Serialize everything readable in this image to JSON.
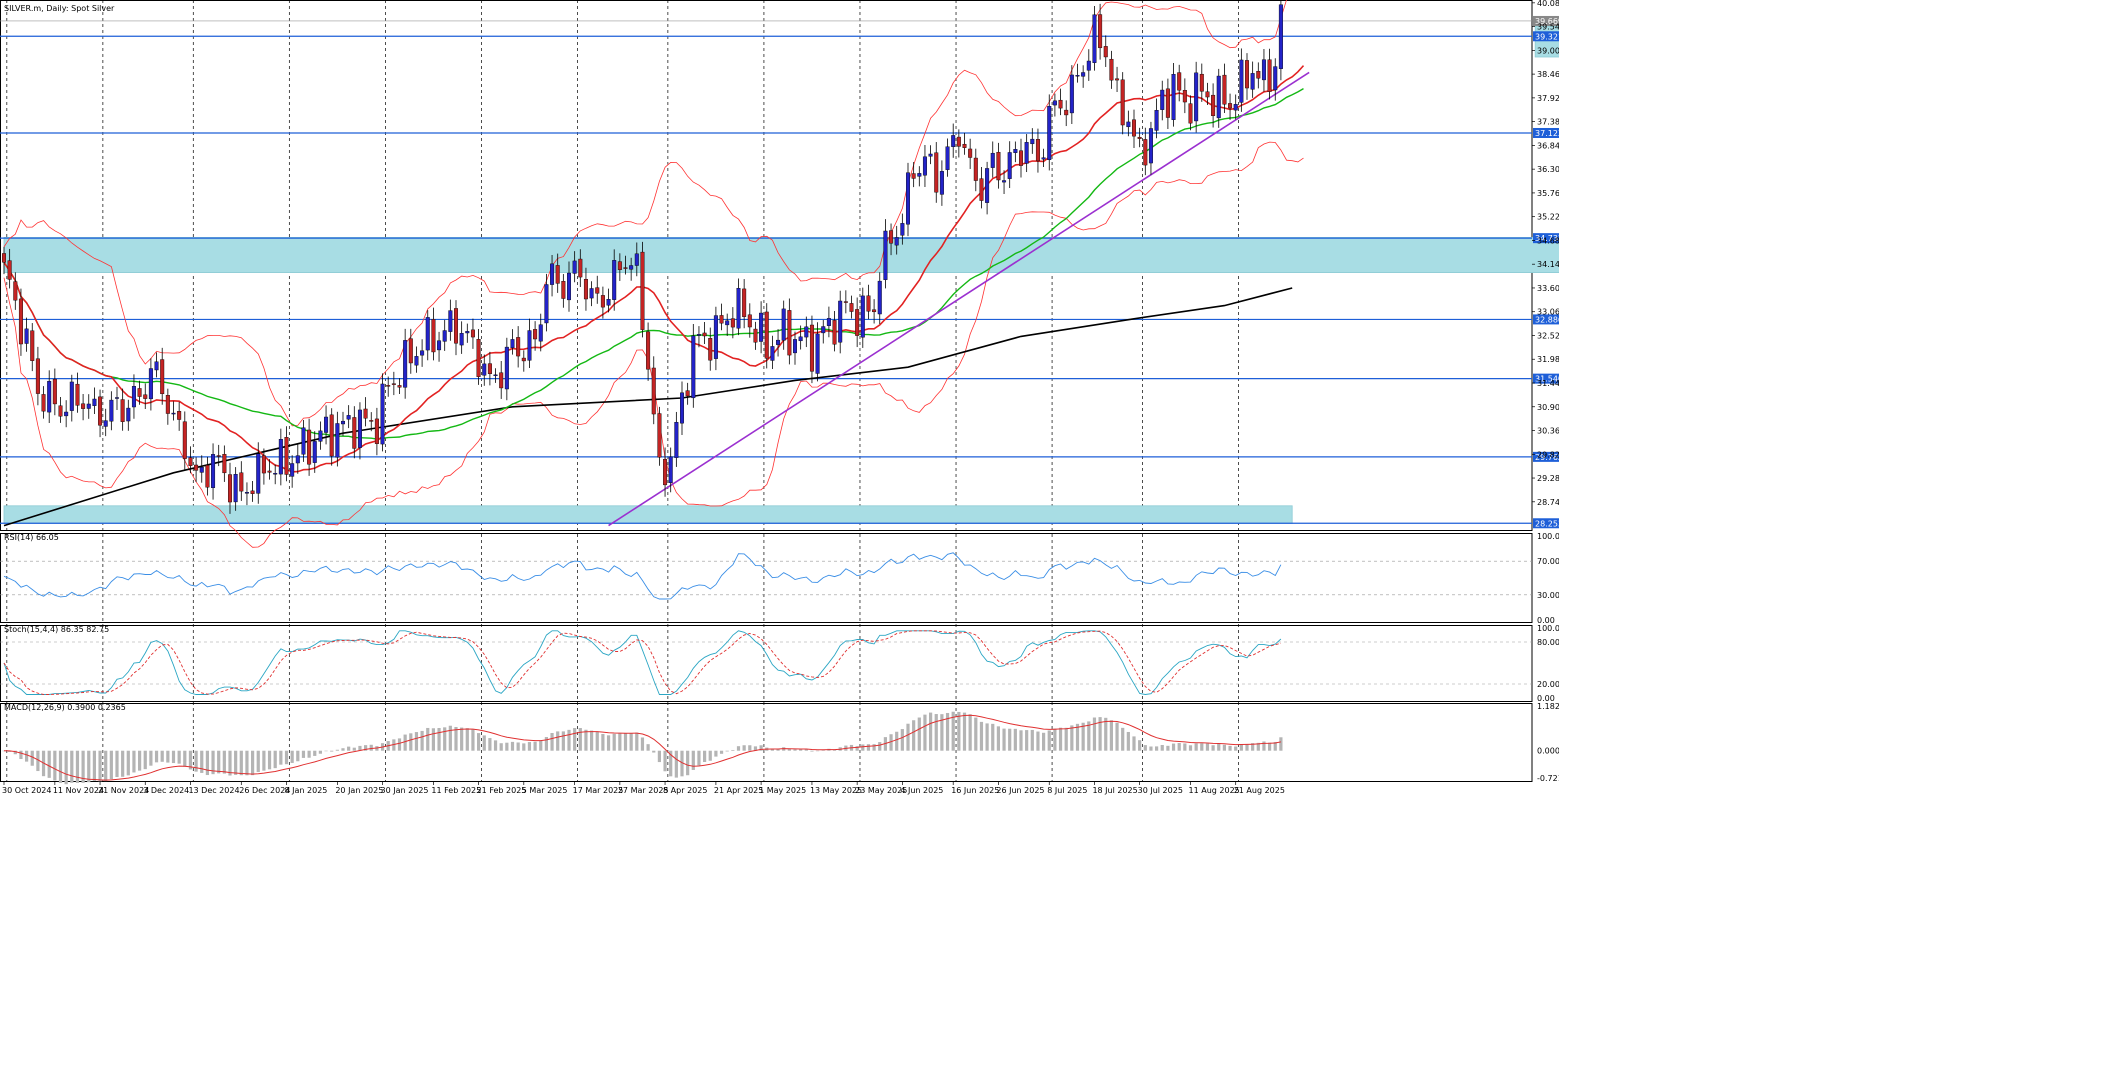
{
  "header": {
    "main": "SILVER.m, Daily:  Spot Silver",
    "rsi": "RSI(14) 66.05",
    "stoch": "Stoch(15,4,4) 86.35 82.75",
    "macd": "MACD(12,26,9) 0.3900 0.2365"
  },
  "colors": {
    "bull": "#2323c8",
    "bear": "#c42424",
    "ma20": "#e22222",
    "ma50": "#14b814",
    "ma200": "#000000",
    "bands": "#ff3333",
    "trend": "#9b30d0",
    "levels": "#1e5fd8",
    "zones": "#a8dde4",
    "rsi": "#3a8ee6",
    "stoch_main": "#2ba6c4",
    "stoch_signal": "#e03030",
    "macd_hist": "#b4b4b4",
    "macd_signal": "#e03030"
  },
  "chart_data": {
    "type": "candlestick",
    "price_axis": {
      "min": 28.1,
      "max": 40.1,
      "ticks": [
        "40.081",
        "39.541",
        "39.001",
        "38.461",
        "37.921",
        "37.381",
        "36.841",
        "36.301",
        "35.761",
        "35.221",
        "34.681",
        "34.141",
        "33.601",
        "33.061",
        "32.521",
        "31.981",
        "31.441",
        "30.901",
        "30.361",
        "29.821",
        "29.281",
        "28.741"
      ]
    },
    "horizontal_levels": [
      {
        "label": "39.321",
        "value": 39.321
      },
      {
        "label": "37.123",
        "value": 37.123
      },
      {
        "label": "34.733",
        "value": 34.733
      },
      {
        "label": "32.886",
        "value": 32.886
      },
      {
        "label": "31.540",
        "value": 31.54
      },
      {
        "label": "29.762",
        "value": 29.762
      },
      {
        "label": "28.253",
        "value": 28.253
      }
    ],
    "current_price": {
      "label": "39.669",
      "value": 39.669
    },
    "zones": [
      {
        "name": "upper",
        "x0": 271,
        "x1": 331,
        "y0": 38.85,
        "y1": 39.55
      },
      {
        "name": "middle",
        "x0": 0,
        "x1": 288,
        "y0": 33.95,
        "y1": 34.75
      },
      {
        "name": "lower",
        "x0": 0,
        "x1": 228,
        "y0": 28.25,
        "y1": 28.65
      }
    ],
    "x_ticks": [
      {
        "i": 0,
        "label": "30 Oct 2024"
      },
      {
        "i": 9,
        "label": "11 Nov 2024"
      },
      {
        "i": 17,
        "label": "21 Nov 2024"
      },
      {
        "i": 25,
        "label": "3 Dec 2024"
      },
      {
        "i": 33,
        "label": "13 Dec 2024"
      },
      {
        "i": 42,
        "label": "26 Dec 2024"
      },
      {
        "i": 50,
        "label": "8 Jan 2025"
      },
      {
        "i": 59,
        "label": "20 Jan 2025"
      },
      {
        "i": 67,
        "label": "30 Jan 2025"
      },
      {
        "i": 76,
        "label": "11 Feb 2025"
      },
      {
        "i": 84,
        "label": "21 Feb 2025"
      },
      {
        "i": 92,
        "label": "5 Mar 2025"
      },
      {
        "i": 101,
        "label": "17 Mar 2025"
      },
      {
        "i": 109,
        "label": "27 Mar 2025"
      },
      {
        "i": 117,
        "label": "8 Apr 2025"
      },
      {
        "i": 126,
        "label": "21 Apr 2025"
      },
      {
        "i": 134,
        "label": "1 May 2025"
      },
      {
        "i": 143,
        "label": "13 May 2025"
      },
      {
        "i": 151,
        "label": "23 May 2025"
      },
      {
        "i": 159,
        "label": "4 Jun 2025"
      },
      {
        "i": 168,
        "label": "16 Jun 2025"
      },
      {
        "i": 176,
        "label": "26 Jun 2025"
      },
      {
        "i": 185,
        "label": "8 Jul 2025"
      },
      {
        "i": 193,
        "label": "18 Jul 2025"
      },
      {
        "i": 201,
        "label": "30 Jul 2025"
      },
      {
        "i": 210,
        "label": "11 Aug 2025"
      },
      {
        "i": 218,
        "label": "21 Aug 2025"
      }
    ],
    "anchors": [
      [
        0,
        34.0
      ],
      [
        3,
        32.7
      ],
      [
        6,
        31.3
      ],
      [
        10,
        31.0
      ],
      [
        14,
        31.0
      ],
      [
        16,
        30.6
      ],
      [
        20,
        31.0
      ],
      [
        24,
        31.1
      ],
      [
        26,
        31.6
      ],
      [
        28,
        31.3
      ],
      [
        30,
        30.6
      ],
      [
        32,
        30.2
      ],
      [
        34,
        29.3
      ],
      [
        37,
        29.6
      ],
      [
        40,
        29.1
      ],
      [
        42,
        28.9
      ],
      [
        44,
        29.4
      ],
      [
        47,
        29.6
      ],
      [
        50,
        29.5
      ],
      [
        53,
        29.9
      ],
      [
        56,
        30.4
      ],
      [
        60,
        30.4
      ],
      [
        63,
        30.4
      ],
      [
        66,
        30.6
      ],
      [
        68,
        31.5
      ],
      [
        72,
        32.0
      ],
      [
        76,
        32.4
      ],
      [
        80,
        32.9
      ],
      [
        82,
        32.5
      ],
      [
        84,
        32.0
      ],
      [
        86,
        31.3
      ],
      [
        88,
        31.7
      ],
      [
        90,
        32.3
      ],
      [
        94,
        32.4
      ],
      [
        96,
        33.7
      ],
      [
        99,
        33.6
      ],
      [
        102,
        34.1
      ],
      [
        104,
        33.4
      ],
      [
        107,
        33.5
      ],
      [
        110,
        34.2
      ],
      [
        112,
        33.9
      ],
      [
        114,
        32.0
      ],
      [
        116,
        29.5
      ],
      [
        118,
        29.8
      ],
      [
        120,
        30.9
      ],
      [
        122,
        32.2
      ],
      [
        125,
        32.5
      ],
      [
        129,
        33.2
      ],
      [
        131,
        33.0
      ],
      [
        133,
        32.5
      ],
      [
        135,
        32.2
      ],
      [
        138,
        32.7
      ],
      [
        141,
        32.5
      ],
      [
        143,
        32.2
      ],
      [
        146,
        32.6
      ],
      [
        149,
        33.2
      ],
      [
        151,
        33.1
      ],
      [
        153,
        33.1
      ],
      [
        154,
        33.2
      ],
      [
        155,
        34.0
      ],
      [
        157,
        34.6
      ],
      [
        159,
        35.1
      ],
      [
        161,
        36.4
      ],
      [
        163,
        36.6
      ],
      [
        165,
        36.2
      ],
      [
        167,
        36.5
      ],
      [
        169,
        37.1
      ],
      [
        171,
        36.2
      ],
      [
        173,
        36.0
      ],
      [
        175,
        36.5
      ],
      [
        177,
        36.3
      ],
      [
        179,
        36.5
      ],
      [
        181,
        36.8
      ],
      [
        183,
        36.4
      ],
      [
        185,
        37.6
      ],
      [
        187,
        37.9
      ],
      [
        189,
        38.1
      ],
      [
        191,
        38.6
      ],
      [
        193,
        39.2
      ],
      [
        195,
        39.0
      ],
      [
        197,
        37.9
      ],
      [
        199,
        37.6
      ],
      [
        201,
        36.6
      ],
      [
        203,
        37.1
      ],
      [
        205,
        37.7
      ],
      [
        207,
        38.2
      ],
      [
        209,
        37.8
      ],
      [
        211,
        38.2
      ],
      [
        213,
        38.0
      ],
      [
        215,
        37.8
      ],
      [
        217,
        37.7
      ],
      [
        219,
        38.2
      ],
      [
        221,
        38.7
      ],
      [
        223,
        38.4
      ],
      [
        225,
        38.7
      ],
      [
        226,
        39.9
      ]
    ],
    "ma200": [
      [
        0,
        28.2
      ],
      [
        30,
        29.4
      ],
      [
        60,
        30.3
      ],
      [
        90,
        30.9
      ],
      [
        120,
        31.1
      ],
      [
        140,
        31.5
      ],
      [
        160,
        31.8
      ],
      [
        180,
        32.5
      ],
      [
        200,
        32.9
      ],
      [
        216,
        33.2
      ],
      [
        228,
        33.6
      ]
    ],
    "trendline": [
      [
        107,
        28.2
      ],
      [
        231,
        38.5
      ]
    ],
    "rsi": {
      "label_ticks": [
        "100.00",
        "70.00",
        "30.00",
        "0.00"
      ]
    },
    "stoch": {
      "label_ticks": [
        "100.00",
        "80.00",
        "20.00",
        "0.00"
      ]
    },
    "macd": {
      "label_ticks": [
        "1.1828",
        "0.0000",
        "-0.7218"
      ]
    }
  }
}
